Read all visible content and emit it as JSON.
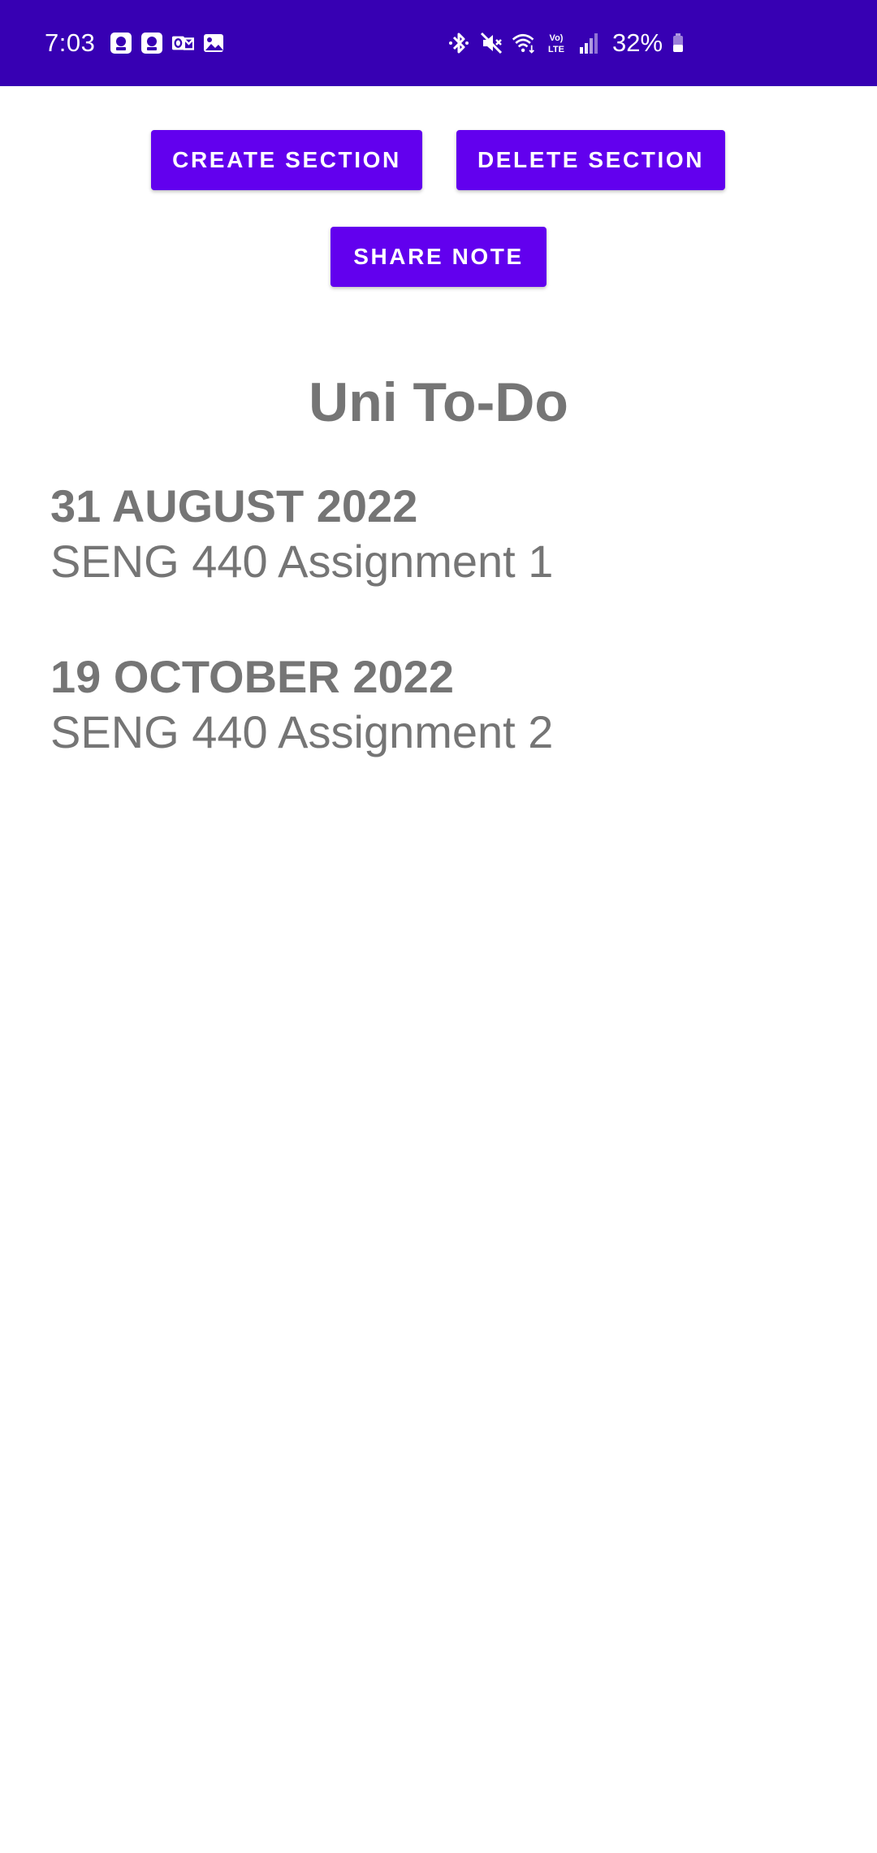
{
  "status_bar": {
    "time": "7:03",
    "battery_percent": "32%",
    "background_color": "#3700b3",
    "notification_icons": [
      "app-notification-icon",
      "app-notification-icon",
      "outlook-icon",
      "gallery-icon"
    ],
    "system_icons": [
      "bluetooth-icon",
      "mute-icon",
      "wifi-icon",
      "volte-icon",
      "signal-icon",
      "battery-icon"
    ],
    "volte_label": "Vo)\nLTE"
  },
  "toolbar": {
    "create_label": "CREATE SECTION",
    "delete_label": "DELETE SECTION",
    "share_label": "SHARE NOTE",
    "button_color": "#6200ee"
  },
  "note": {
    "title": "Uni To-Do",
    "entries": [
      {
        "date": "31 AUGUST 2022",
        "text": "SENG 440 Assignment 1"
      },
      {
        "date": "19 OCTOBER 2022",
        "text": "SENG 440 Assignment 2"
      }
    ],
    "text_color": "#757575"
  }
}
